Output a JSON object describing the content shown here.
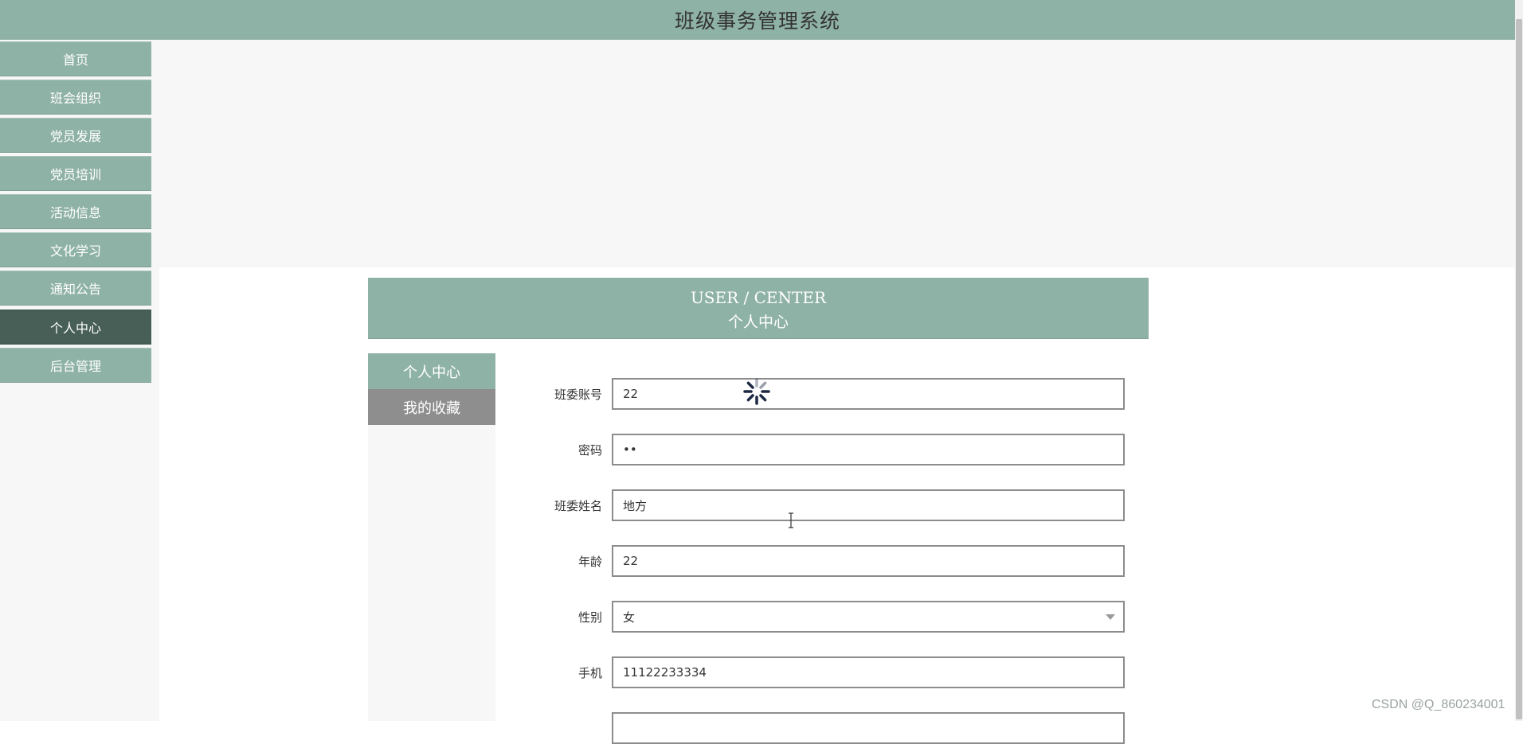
{
  "app": {
    "title": "班级事务管理系统"
  },
  "sidebar": {
    "items": [
      {
        "label": "首页"
      },
      {
        "label": "班会组织"
      },
      {
        "label": "党员发展"
      },
      {
        "label": "党员培训"
      },
      {
        "label": "活动信息"
      },
      {
        "label": "文化学习"
      },
      {
        "label": "通知公告"
      },
      {
        "label": "个人中心",
        "active": true
      },
      {
        "label": "后台管理"
      }
    ]
  },
  "user_center": {
    "title_en": "USER / CENTER",
    "title_zh": "个人中心",
    "tabs": [
      {
        "label": "个人中心"
      },
      {
        "label": "我的收藏"
      }
    ],
    "form": {
      "account": {
        "label": "班委账号",
        "value": "22"
      },
      "password": {
        "label": "密码",
        "value": "••"
      },
      "name": {
        "label": "班委姓名",
        "value": "地方"
      },
      "age": {
        "label": "年龄",
        "value": "22"
      },
      "gender": {
        "label": "性别",
        "value": "女"
      },
      "phone": {
        "label": "手机",
        "value": "11122233334"
      }
    }
  },
  "watermark": "CSDN @Q_860234001",
  "colors": {
    "accent": "#8fb2a6",
    "active_nav": "#475f57",
    "secondary_tab": "#8e8e8e"
  }
}
